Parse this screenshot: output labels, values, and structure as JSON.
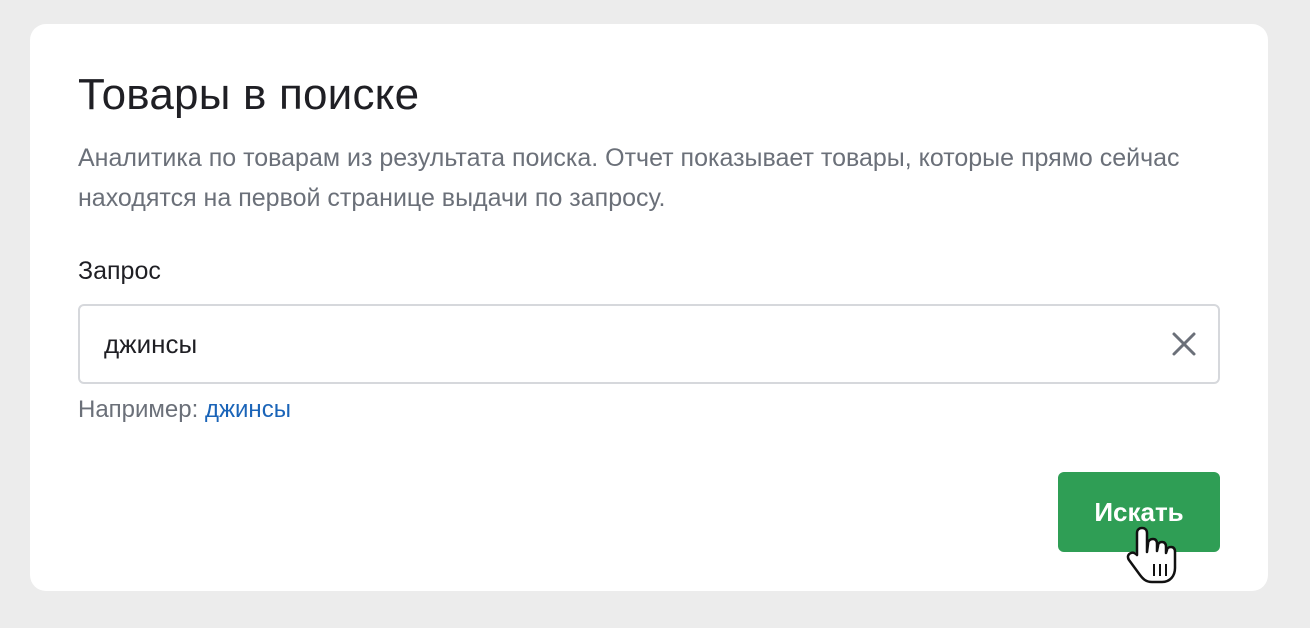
{
  "card": {
    "title": "Товары в поиске",
    "description": "Аналитика по товарам из результата поиска. Отчет показывает товары, которые прямо сейчас находятся на первой странице выдачи по запросу."
  },
  "query": {
    "label": "Запрос",
    "value": "джинсы",
    "clear_icon": "close-icon"
  },
  "hint": {
    "prefix": "Например:",
    "example": "джинсы"
  },
  "submit": {
    "label": "Искать"
  },
  "colors": {
    "background": "#ececec",
    "card": "#ffffff",
    "button": "#2f9e55",
    "link": "#1a64b8",
    "muted_text": "#6b7079"
  }
}
